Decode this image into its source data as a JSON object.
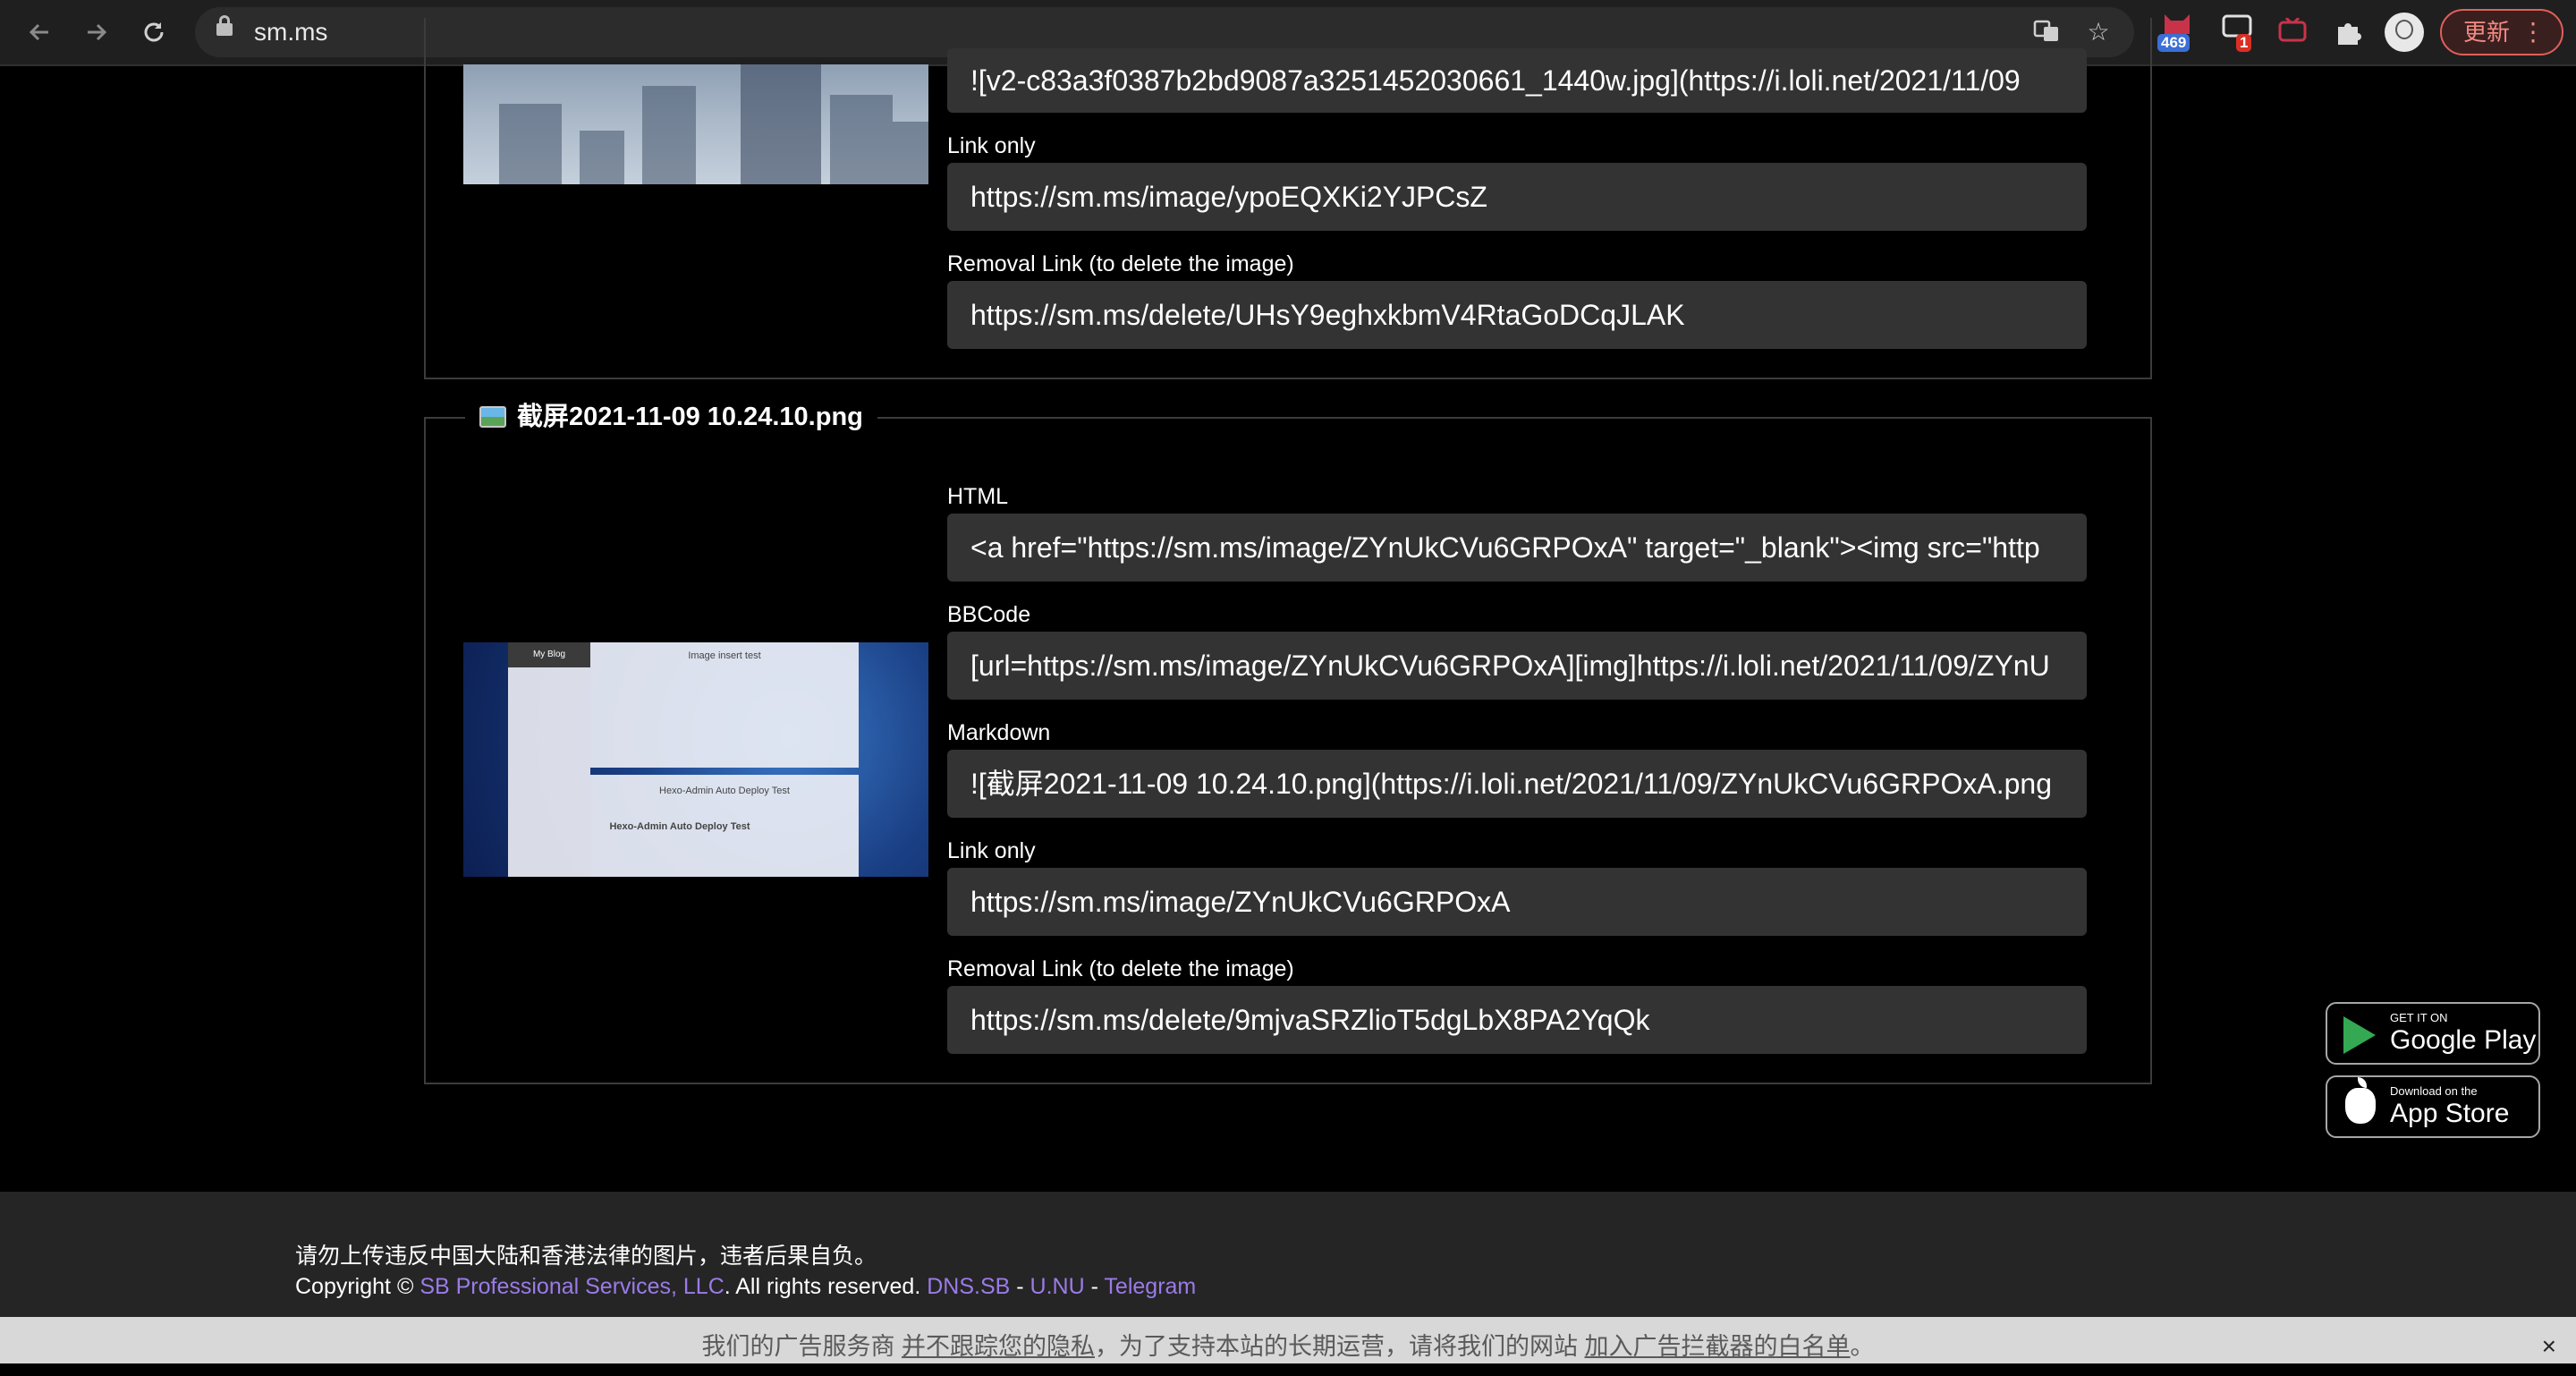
{
  "browser": {
    "url": "sm.ms",
    "extension_badges": [
      "469",
      "1"
    ],
    "update_label": "更新"
  },
  "image1": {
    "markdown_value": "![v2-c83a3f0387b2bd9087a3251452030661_1440w.jpg](https://i.loli.net/2021/11/09",
    "link_only_label": "Link only",
    "link_only_value": "https://sm.ms/image/ypoEQXKi2YJPCsZ",
    "removal_label": "Removal Link (to delete the image)",
    "removal_value": "https://sm.ms/delete/UHsY9eghxkbmV4RtaGoDCqJLAK"
  },
  "image2": {
    "filename": "截屏2021-11-09 10.24.10.png",
    "html_label": "HTML",
    "html_value": "<a href=\"https://sm.ms/image/ZYnUkCVu6GRPOxA\" target=\"_blank\"><img src=\"http",
    "bbcode_label": "BBCode",
    "bbcode_value": "[url=https://sm.ms/image/ZYnUkCVu6GRPOxA][img]https://i.loli.net/2021/11/09/ZYnU",
    "markdown_label": "Markdown",
    "markdown_value": "![截屏2021-11-09 10.24.10.png](https://i.loli.net/2021/11/09/ZYnUkCVu6GRPOxA.png",
    "link_only_label": "Link only",
    "link_only_value": "https://sm.ms/image/ZYnUkCVu6GRPOxA",
    "removal_label": "Removal Link (to delete the image)",
    "removal_value": "https://sm.ms/delete/9mjvaSRZlioT5dgLbX8PA2YqQk",
    "thumbnail": {
      "sidebar_title": "My Blog",
      "post1_title": "Image insert test",
      "post2_title": "Hexo-Admin Auto Deploy Test",
      "post3_title": "Hexo-Admin Auto Deploy Test"
    }
  },
  "stores": {
    "google_small": "GET IT ON",
    "google_big": "Google Play",
    "apple_small": "Download on the",
    "apple_big": "App Store"
  },
  "footer": {
    "warning": "请勿上传违反中国大陆和香港法律的图片，违者后果自负。",
    "copyright_prefix": "Copyright © ",
    "company": "SB Professional Services, LLC",
    "rights": ". All rights reserved. ",
    "link_dns": "DNS.SB",
    "sep1": " - ",
    "link_unu": "U.NU",
    "sep2": " - ",
    "link_telegram": "Telegram"
  },
  "adbar": {
    "part1": "我们的广告服务商 ",
    "link1": "并不跟踪您的隐私",
    "part2": "，为了支持本站的长期运营，请将我们的网站 ",
    "link2": "加入广告拦截器的白名单",
    "part3": "。",
    "close": "×"
  }
}
